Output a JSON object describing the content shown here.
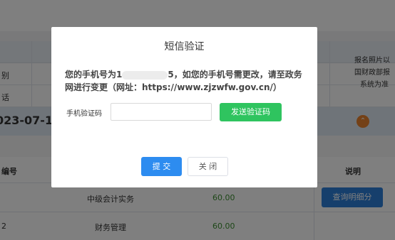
{
  "background": {
    "table_labels": {
      "row1": "别",
      "row2": "话"
    },
    "note_lines": [
      "报名照片以",
      "国财政部报",
      "系统为准"
    ],
    "date_text": "023-07-1",
    "columns": {
      "code": "编号",
      "desc": "说明"
    },
    "subjects": [
      {
        "code": "",
        "name": "中级会计实务",
        "score": "60.00",
        "action": "查询明细分"
      },
      {
        "code": "2",
        "name": "财务管理",
        "score": "60.00",
        "action": ""
      }
    ],
    "collapse_icon": "chevron-up-icon"
  },
  "modal": {
    "title": "短信验证",
    "message_prefix": "您的手机号为1",
    "message_masked_tail": "5",
    "message_suffix": "，如您的手机号需更改，请至政务网进行变更（网址：https://www.zjzwfw.gov.cn/）",
    "code_label": "手机验证码",
    "code_value": "",
    "send_button": "发送验证码",
    "submit_button": "提 交",
    "close_button": "关 闭"
  },
  "colors": {
    "primary": "#2d8cf0",
    "send": "#2fc45f",
    "accent": "#e8822e",
    "score": "#3a8e2f"
  }
}
